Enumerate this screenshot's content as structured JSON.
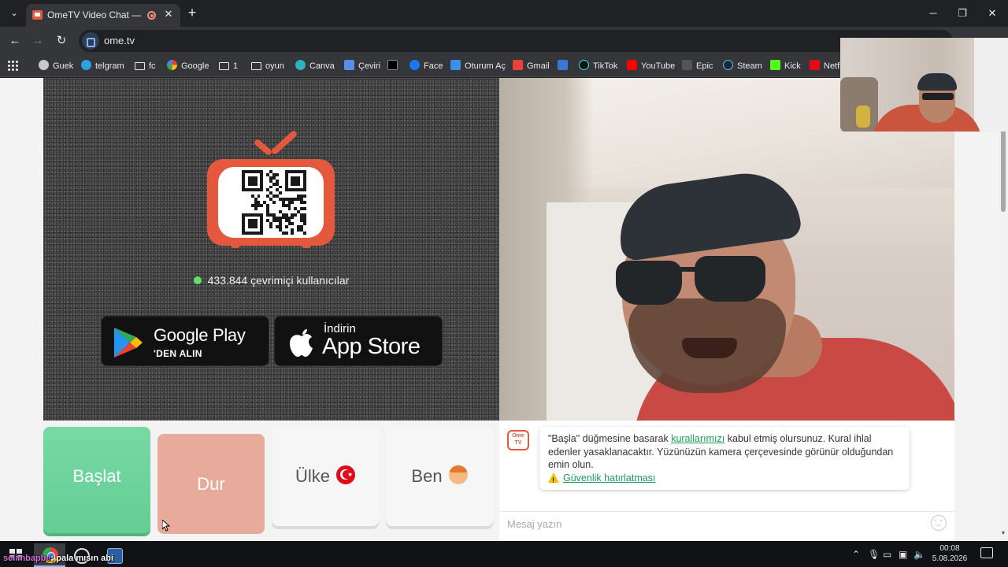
{
  "browser": {
    "tab_title": "OmeTV Video Chat — Ome",
    "url": "ome.tv",
    "bookmarks": [
      "Guek",
      "telgram",
      "fc",
      "Google",
      "1",
      "oyun",
      "Canva",
      "Çeviri",
      "",
      "Face",
      "Oturum Aç",
      "Gmail",
      "",
      "TikTok",
      "YouTube",
      "Epic",
      "Steam",
      "Kick",
      "Netfl"
    ]
  },
  "left_panel": {
    "online_text": "433.844 çevrimiçi kullanıcılar",
    "google_play": {
      "top": "Google Play",
      "sub": "'DEN ALIN"
    },
    "app_store": {
      "top": "İndirin",
      "main": "App Store"
    }
  },
  "controls": {
    "start": "Başlat",
    "stop": "Dur",
    "country": "Ülke",
    "me": "Ben"
  },
  "chat": {
    "logo_text": "Ome\nTV",
    "msg_part1": "\"Başla\" düğmesine basarak ",
    "rules_link": "kurallarımızı",
    "msg_part2": " kabul etmiş olursunuz. Kural ihlal edenler yasaklanacaktır. Yüzünüzün kamera çerçevesinde görünür olduğundan emin olun.",
    "safety_link": "Güvenlik hatırlatması",
    "input_placeholder": "Mesaj yazın"
  },
  "taskbar": {
    "overlay_user": "selimbapbe",
    "overlay_msg": ": pala mısın abi",
    "time": "00:08",
    "date": "5.08.2026"
  },
  "colors": {
    "brand": "#e4583e",
    "start_green": "#6ad39a",
    "stop_salmon": "#e7ab9c",
    "link_green": "#1c9e5c",
    "online_dot": "#5fe06e"
  }
}
